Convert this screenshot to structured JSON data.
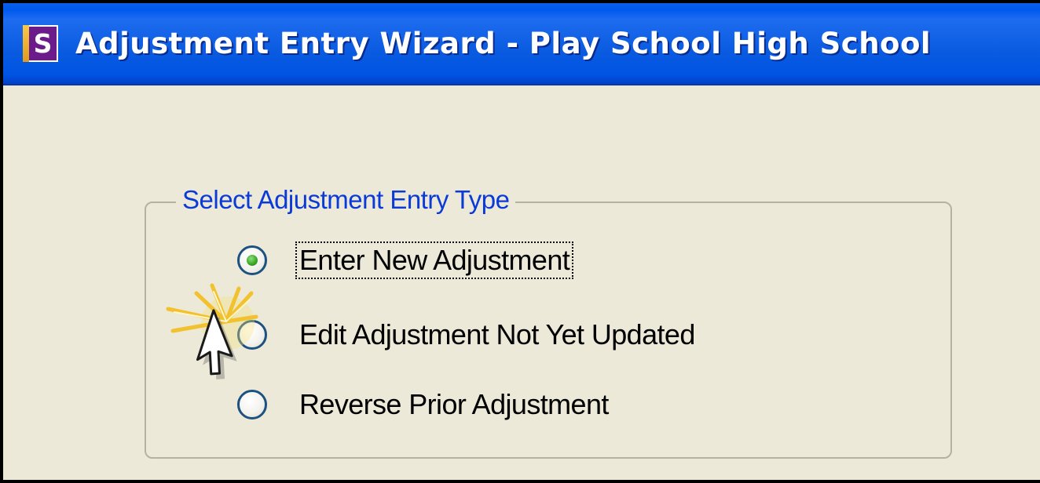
{
  "window": {
    "app_icon_letter": "S",
    "title": "Adjustment Entry Wizard - Play School High School"
  },
  "group": {
    "legend": "Select Adjustment Entry Type",
    "options": [
      {
        "label": "Enter New Adjustment",
        "selected": true,
        "focused": true
      },
      {
        "label": "Edit Adjustment Not Yet Updated",
        "selected": false,
        "focused": false
      },
      {
        "label": "Reverse Prior Adjustment",
        "selected": false,
        "focused": false
      }
    ]
  },
  "colors": {
    "titlebar": "#0054E3",
    "dialog_background": "#ECE9D8",
    "legend_text": "#0A3AD8",
    "radio_selected_dot": "#3DAA2A",
    "click_highlight": "#F2C12E"
  },
  "icons": {
    "app_icon": "app-s-icon",
    "cursor": "mouse-pointer-icon",
    "click_effect": "click-burst-icon"
  }
}
